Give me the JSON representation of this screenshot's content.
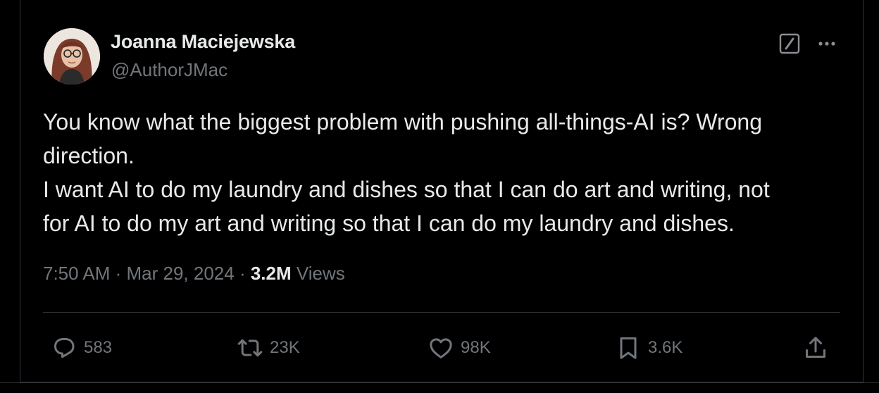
{
  "author": {
    "name": "Joanna Maciejewska",
    "handle": "@AuthorJMac"
  },
  "tweet": {
    "lines": [
      "You know what the biggest problem with pushing all-things-AI is? Wrong",
      "direction.",
      "I want AI to do my laundry and dishes so that I can do art and writing, not",
      "for AI to do my art and writing so that I can do my laundry and dishes."
    ]
  },
  "meta": {
    "time": "7:50 AM",
    "separator": " · ",
    "date": "Mar 29, 2024",
    "views_count": "3.2M",
    "views_label": "Views"
  },
  "actions": {
    "replies": "583",
    "reposts": "23K",
    "likes": "98K",
    "bookmarks": "3.6K"
  },
  "icons": {
    "reply": "speech-bubble-icon",
    "repost": "repost-arrows-icon",
    "like": "heart-icon",
    "bookmark": "bookmark-icon",
    "share": "share-upload-icon",
    "grok": "grok-slash-icon",
    "more": "ellipsis-icon"
  },
  "colors": {
    "background": "#000000",
    "text": "#e7e9ea",
    "muted": "#71767b",
    "border": "#2f3336"
  }
}
